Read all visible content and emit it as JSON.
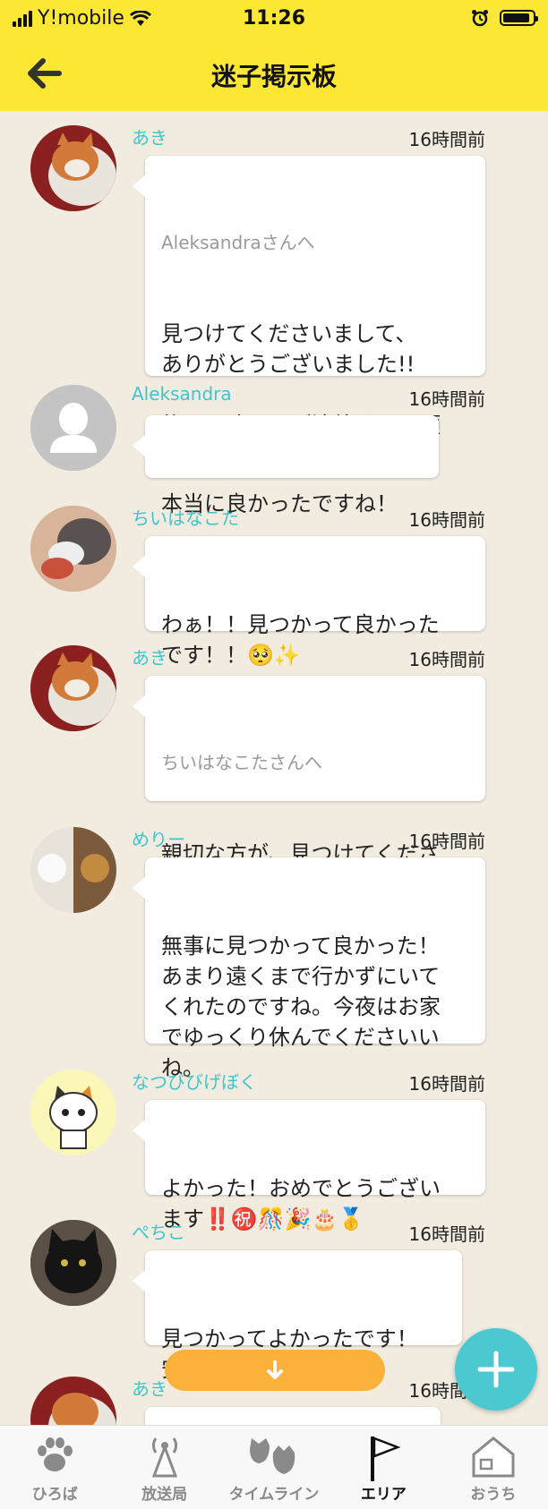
{
  "status": {
    "carrier": "Y!mobile",
    "time": "11:26",
    "battery_level": 0.9
  },
  "header": {
    "title": "迷子掲示板"
  },
  "posts": [
    {
      "user": "あき",
      "time": "16時間前",
      "reply_to": "Aleksandraさんへ",
      "text": "見つけてくださいまして、\nありがとうございました!!\n\n後日、改めてご連絡させて頂\nきます。"
    },
    {
      "user": "Aleksandra",
      "time": "16時間前",
      "reply_to": "",
      "text": "本当に良かったですね！"
    },
    {
      "user": "ちいはなこた",
      "time": "16時間前",
      "reply_to": "",
      "text": "わぁ！！見つかって良かった\nです！！🥺✨"
    },
    {
      "user": "あき",
      "time": "16時間前",
      "reply_to": "ちいはなこたさんへ",
      "text": "親切な方が、見つけてくださ\nいました。"
    },
    {
      "user": "めりー",
      "time": "16時間前",
      "reply_to": "",
      "text": "無事に見つかって良かった！\nあまり遠くまで行かずにいて\nくれたのですね。今夜はお家\nでゆっくり休んでくださいい\nね。"
    },
    {
      "user": "なつびびげぼく",
      "time": "16時間前",
      "reply_to": "",
      "text": "よかった！おめでとうござい\nます‼️㊗️🎊🎉🎂🥇"
    },
    {
      "user": "ぺちこ",
      "time": "16時間前",
      "reply_to": "",
      "text": "見つかってよかったです！\n安心しました☺️"
    },
    {
      "user": "あき",
      "time": "16時間前",
      "reply_to": "",
      "text": ""
    }
  ],
  "tabs": [
    {
      "label": "ひろば",
      "icon": "paw-icon",
      "active": false
    },
    {
      "label": "放送局",
      "icon": "broadcast-tower-icon",
      "active": false
    },
    {
      "label": "タイムライン",
      "icon": "cat-masks-icon",
      "active": false
    },
    {
      "label": "エリア",
      "icon": "flag-icon",
      "active": true
    },
    {
      "label": "おうち",
      "icon": "house-icon",
      "active": false
    }
  ],
  "colors": {
    "header": "#fde735",
    "accent": "#4cc8d0",
    "username": "#3fc4cc",
    "scroll_button": "#fbb13a",
    "background": "#f2ece0"
  }
}
